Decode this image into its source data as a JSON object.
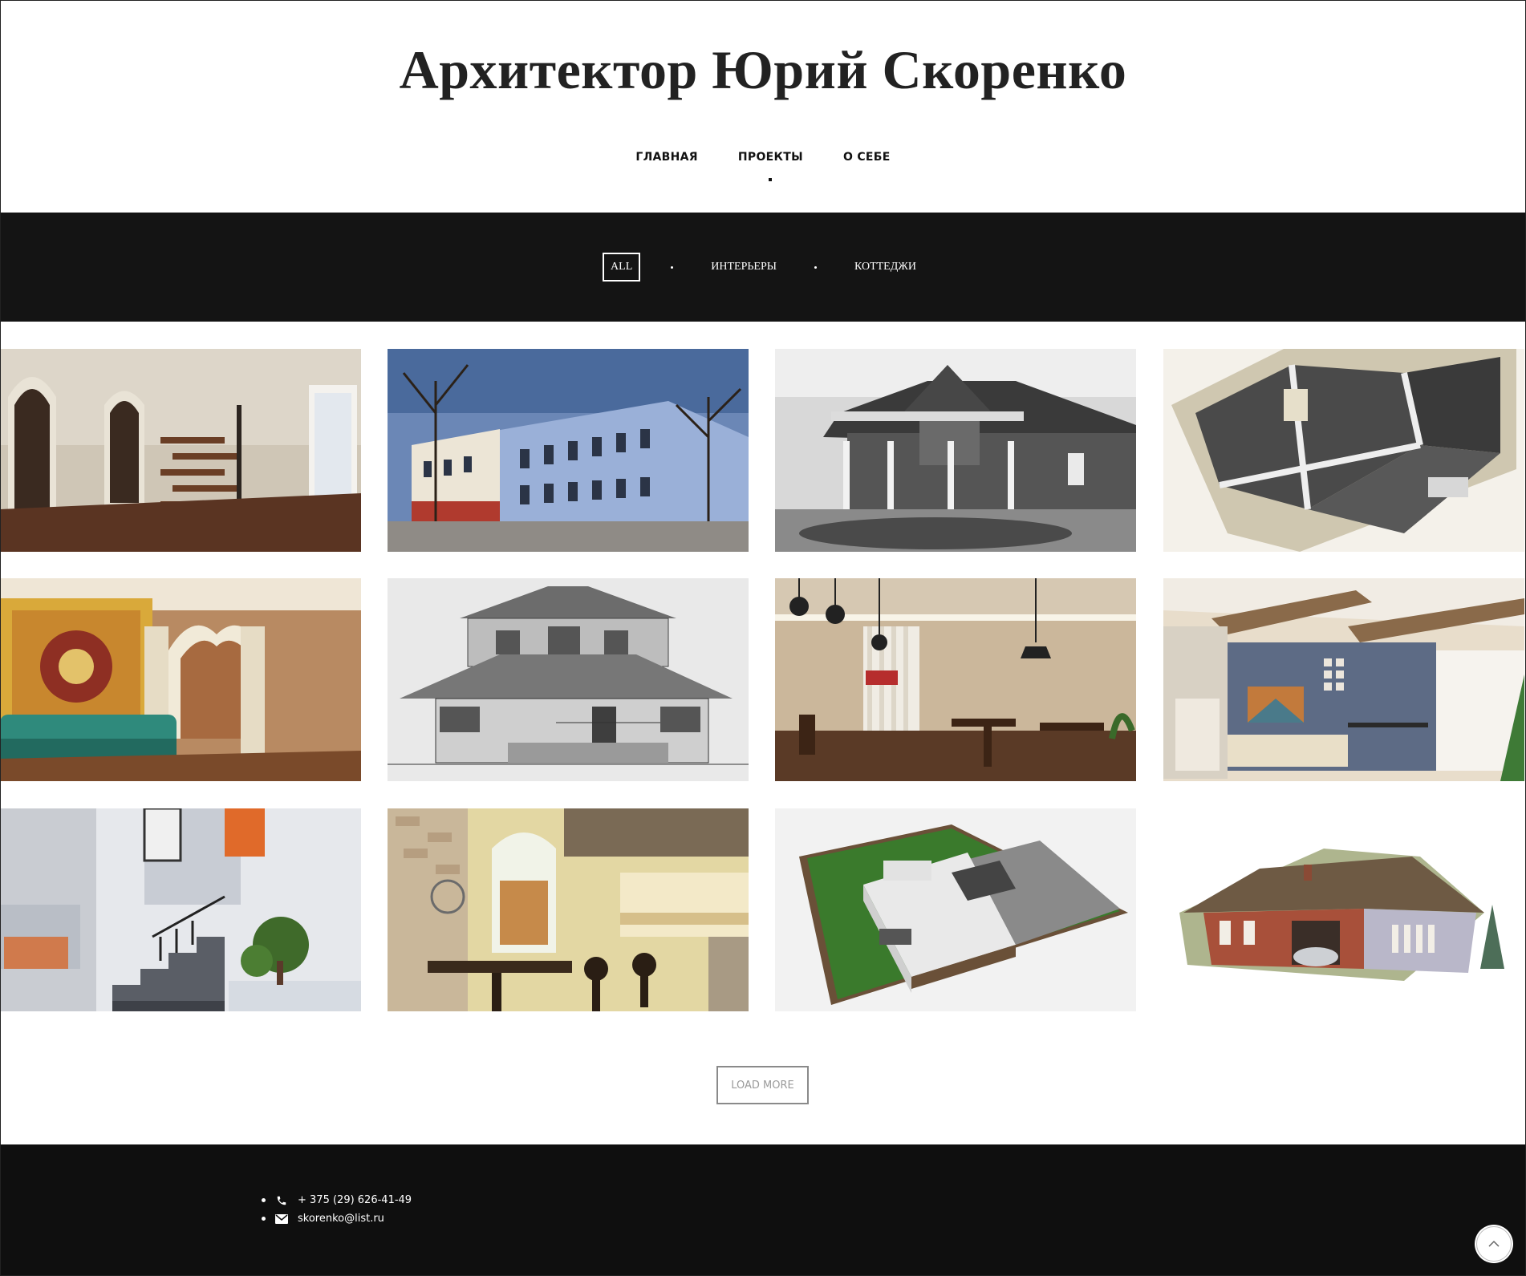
{
  "site": {
    "title": "Архитектор Юрий Скоренко"
  },
  "nav": {
    "items": [
      {
        "label": "ГЛАВНАЯ",
        "active": false
      },
      {
        "label": "ПРОЕКТЫ",
        "active": true
      },
      {
        "label": "О СЕБЕ",
        "active": false
      }
    ]
  },
  "filters": {
    "items": [
      {
        "label": "ALL",
        "active": true
      },
      {
        "label": "ИНТЕРЬЕРЫ",
        "active": false
      },
      {
        "label": "КОТТЕДЖИ",
        "active": false
      }
    ]
  },
  "gallery": {
    "tiles": [
      {
        "name": "interior-spiral-staircase"
      },
      {
        "name": "blue-historic-building"
      },
      {
        "name": "brick-house-with-pond"
      },
      {
        "name": "3d-floor-plan"
      },
      {
        "name": "oriental-interior"
      },
      {
        "name": "house-sketch"
      },
      {
        "name": "loft-cafe-interior"
      },
      {
        "name": "living-room-beams"
      },
      {
        "name": "white-staircase-interior"
      },
      {
        "name": "bakery-cafe-interior"
      },
      {
        "name": "modern-villa-model"
      },
      {
        "name": "brick-cottage-model"
      }
    ]
  },
  "load_more": {
    "label": "LOAD MORE"
  },
  "footer": {
    "phone": "+ 375 (29) 626-41-49",
    "email": "skorenko@list.ru"
  },
  "icons": {
    "phone": "phone-icon",
    "email": "envelope-icon",
    "scroll_top": "chevron-up-icon"
  }
}
